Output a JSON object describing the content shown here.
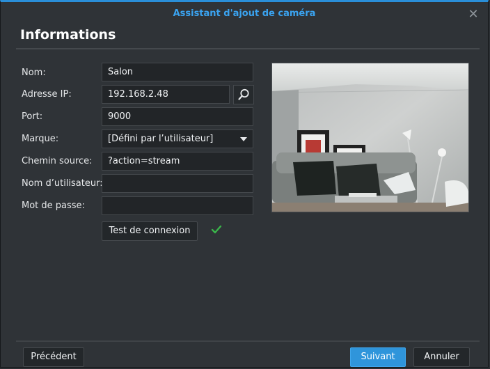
{
  "dialog": {
    "title": "Assistant d'ajout de caméra",
    "section_title": "Informations",
    "accent_color": "#2a8fd9"
  },
  "form": {
    "labels": {
      "name": "Nom:",
      "ip": "Adresse IP:",
      "port": "Port:",
      "brand": "Marque:",
      "source_path": "Chemin source:",
      "username": "Nom d’utilisateur:",
      "password": "Mot de passe:"
    },
    "values": {
      "name": "Salon",
      "ip": "192.168.2.48",
      "port": "9000",
      "brand": "[Défini par l’utilisateur]",
      "source_path": "?action=stream",
      "username": "",
      "password": ""
    },
    "test_button": "Test de connexion",
    "test_status_color": "#3ab54a"
  },
  "footer": {
    "previous": "Précédent",
    "next": "Suivant",
    "cancel": "Annuler"
  },
  "icons": {
    "close": "close-icon",
    "search": "search-icon",
    "dropdown": "chevron-down-icon",
    "status": "checkmark-icon"
  }
}
